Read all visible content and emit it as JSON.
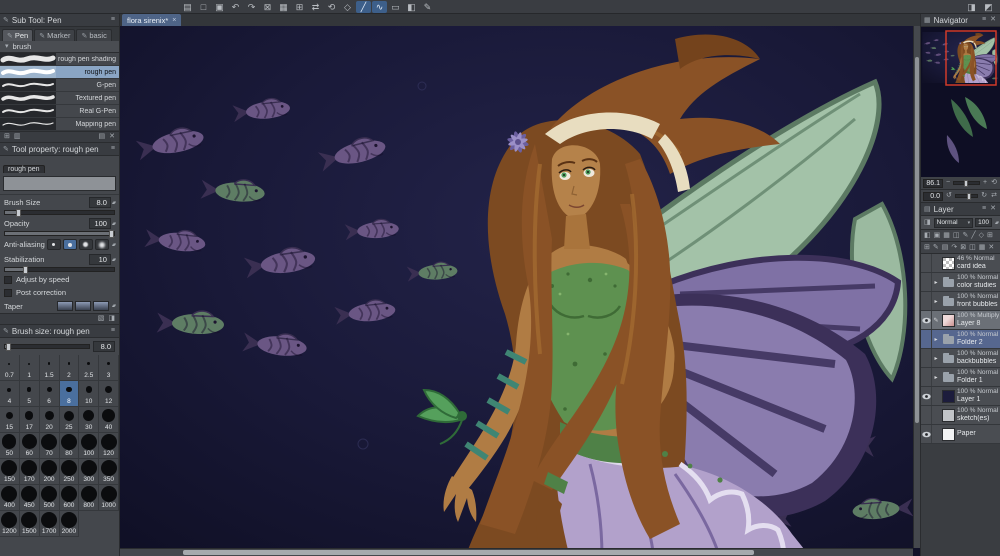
{
  "toolbar": {
    "icons": [
      {
        "name": "new-file-icon",
        "glyph": "▤"
      },
      {
        "name": "open-file-icon",
        "glyph": "□"
      },
      {
        "name": "save-icon",
        "glyph": "▣"
      },
      {
        "name": "undo-icon",
        "glyph": "↶"
      },
      {
        "name": "redo-icon",
        "glyph": "↷"
      },
      {
        "name": "delete-icon",
        "glyph": "⊠"
      },
      {
        "name": "fill-icon",
        "glyph": "▦"
      },
      {
        "name": "grid-icon",
        "glyph": "⊞"
      },
      {
        "name": "flip-horizontal-icon",
        "glyph": "⇄"
      },
      {
        "name": "rotate-reset-icon",
        "glyph": "⟲"
      },
      {
        "name": "transform-icon",
        "glyph": "◇"
      },
      {
        "name": "snap-ruler-icon",
        "glyph": "╱",
        "active": true
      },
      {
        "name": "snap-special-ruler-icon",
        "glyph": "∿",
        "active": true
      },
      {
        "name": "selection-icon",
        "glyph": "▭"
      },
      {
        "name": "crop-icon",
        "glyph": "◧"
      },
      {
        "name": "object-icon",
        "glyph": "✎"
      }
    ],
    "right_icons": [
      {
        "name": "panel-toggle-icon",
        "glyph": "◨"
      },
      {
        "name": "workspace-icon",
        "glyph": "◩"
      }
    ]
  },
  "doc_tab": {
    "label": "flora sirenix*",
    "close_glyph": "×"
  },
  "sub_tool": {
    "title": "Sub Tool: Pen",
    "tabs": [
      {
        "label": "Pen",
        "icon": "✎",
        "active": true
      },
      {
        "label": "Marker",
        "icon": "✎",
        "active": false
      },
      {
        "label": "basic",
        "icon": "✎",
        "active": false
      }
    ],
    "group_label": "brush",
    "group_icon": "▾",
    "brushes": [
      "rough pen shading",
      "rough pen",
      "G-pen",
      "Textured pen",
      "Real G-Pen",
      "Mapping pen"
    ],
    "selected_brush": "rough pen",
    "footer_left": [
      {
        "name": "add-subtool-icon",
        "glyph": "⊞"
      },
      {
        "name": "subtool-settings-icon",
        "glyph": "▥"
      }
    ],
    "footer_right": [
      {
        "name": "duplicate-subtool-icon",
        "glyph": "▤"
      },
      {
        "name": "delete-subtool-icon",
        "glyph": "✕"
      }
    ]
  },
  "tool_property": {
    "title": "Tool property: rough pen",
    "preset_label": "rough pen",
    "brush_size_label": "Brush Size",
    "brush_size_value": "8.0",
    "opacity_label": "Opacity",
    "opacity_value": "100",
    "anti_aliasing_label": "Anti-aliasing",
    "stabilization_label": "Stabilization",
    "stabilization_value": "10",
    "adjust_by_speed_label": "Adjust by speed",
    "post_correction_label": "Post correction",
    "taper_label": "Taper",
    "spinner_glyph": "▴▾",
    "footer_icons": [
      {
        "name": "tool-property-lock-icon",
        "glyph": "▧"
      },
      {
        "name": "tool-property-detail-icon",
        "glyph": "◨"
      }
    ]
  },
  "brush_size_panel": {
    "title": "Brush size: rough pen",
    "current_value": "8.0",
    "selected": "8",
    "sizes": [
      "0.7",
      "1",
      "1.5",
      "2",
      "2.5",
      "3",
      "4",
      "5",
      "6",
      "8",
      "10",
      "12",
      "15",
      "17",
      "20",
      "25",
      "30",
      "40",
      "50",
      "60",
      "70",
      "80",
      "100",
      "120",
      "150",
      "170",
      "200",
      "250",
      "300",
      "350",
      "400",
      "450",
      "500",
      "600",
      "800",
      "1000",
      "1200",
      "1500",
      "1700",
      "2000"
    ]
  },
  "navigator": {
    "title": "Navigator",
    "zoom_value": "86.1",
    "rotation_value": "0.0",
    "icons": {
      "zoom_out": "−",
      "zoom_in": "+",
      "fit": "⟲",
      "flip": "⇄",
      "rotate_left": "↺",
      "rotate_right": "↻",
      "rotate_reset": "⟲"
    },
    "header_icons": [
      {
        "name": "navigator-menu-icon",
        "glyph": "≡"
      },
      {
        "name": "navigator-close-icon",
        "glyph": "✕"
      }
    ]
  },
  "layer_panel": {
    "title": "Layer",
    "blend_mode": "Normal",
    "opacity_value": "100",
    "icons": {
      "blend": "◨",
      "caret_down": "▾",
      "opacity_spin": "▴▾"
    },
    "header_icons": [
      {
        "name": "layer-menu-icon",
        "glyph": "≡"
      },
      {
        "name": "layer-close-icon",
        "glyph": "✕"
      }
    ],
    "toolbar_row1": [
      {
        "name": "clip-to-layer-below-icon",
        "glyph": "◧"
      },
      {
        "name": "lock-layer-icon",
        "glyph": "▣"
      },
      {
        "name": "lock-transparent-pixels-icon",
        "glyph": "▦"
      },
      {
        "name": "enable-mask-icon",
        "glyph": "◫"
      },
      {
        "name": "set-as-draft-icon",
        "glyph": "✎"
      },
      {
        "name": "ruler-icon",
        "glyph": "╱"
      },
      {
        "name": "reference-layer-icon",
        "glyph": "◇"
      },
      {
        "name": "two-pane-icon",
        "glyph": "⊞"
      }
    ],
    "toolbar_row2": [
      {
        "name": "new-raster-layer-icon",
        "glyph": "⊞"
      },
      {
        "name": "new-vector-layer-icon",
        "glyph": "✎"
      },
      {
        "name": "new-folder-icon",
        "glyph": "▤"
      },
      {
        "name": "transfer-down-icon",
        "glyph": "↷"
      },
      {
        "name": "merge-down-icon",
        "glyph": "⊠"
      },
      {
        "name": "create-mask-icon",
        "glyph": "◫"
      },
      {
        "name": "apply-mask-icon",
        "glyph": "▦"
      },
      {
        "name": "delete-layer-icon",
        "glyph": "✕"
      }
    ],
    "layers": [
      {
        "eye": false,
        "edit": false,
        "thumb": "checker",
        "opacity": "46",
        "mode": "Normal",
        "name": "card idea",
        "selected": ""
      },
      {
        "eye": false,
        "edit": false,
        "thumb": "folder",
        "opacity": "100",
        "mode": "Normal",
        "name": "color studies",
        "selected": ""
      },
      {
        "eye": false,
        "edit": false,
        "thumb": "folder",
        "opacity": "100",
        "mode": "Normal",
        "name": "front bubbles",
        "selected": ""
      },
      {
        "eye": true,
        "edit": true,
        "thumb": "pink",
        "opacity": "100",
        "mode": "Multiply",
        "name": "Layer 8",
        "selected": "light"
      },
      {
        "eye": false,
        "edit": false,
        "thumb": "folder",
        "opacity": "100",
        "mode": "Normal",
        "name": "Folder 2",
        "selected": "blue"
      },
      {
        "eye": false,
        "edit": false,
        "thumb": "folder",
        "opacity": "100",
        "mode": "Normal",
        "name": "backbubbles",
        "selected": ""
      },
      {
        "eye": false,
        "edit": false,
        "thumb": "folder",
        "opacity": "100",
        "mode": "Normal",
        "name": "Folder 1",
        "selected": ""
      },
      {
        "eye": true,
        "edit": false,
        "thumb": "navy",
        "opacity": "100",
        "mode": "Normal",
        "name": "Layer 1",
        "selected": ""
      },
      {
        "eye": false,
        "edit": false,
        "thumb": "gray",
        "opacity": "100",
        "mode": "Normal",
        "name": "sketch(es)",
        "selected": ""
      },
      {
        "eye": true,
        "edit": false,
        "thumb": "white",
        "opacity": "",
        "mode": "",
        "name": "Paper",
        "selected": ""
      }
    ]
  }
}
